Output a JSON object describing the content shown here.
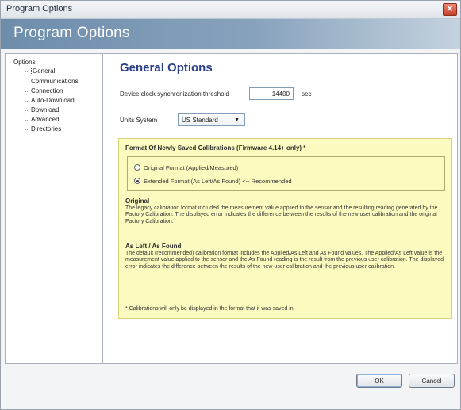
{
  "window": {
    "title": "Program Options",
    "close_glyph": "✕"
  },
  "banner": {
    "title": "Program Options"
  },
  "tree": {
    "root": "Options",
    "items": [
      {
        "label": "General",
        "selected": true
      },
      {
        "label": "Communications"
      },
      {
        "label": "Connection"
      },
      {
        "label": "Auto-Download"
      },
      {
        "label": "Download"
      },
      {
        "label": "Advanced"
      },
      {
        "label": "Directories"
      }
    ]
  },
  "general": {
    "heading": "General Options",
    "clock_label": "Device clock synchronization threshold",
    "clock_value": "14400",
    "clock_unit": "sec",
    "units_label": "Units System",
    "units_value": "US Standard",
    "units_arrow": "▼"
  },
  "format": {
    "title": "Format Of Newly Saved Calibrations (Firmware 4.14+ only) *",
    "option_original": "Original Format (Applied/Measured)",
    "option_extended": "Extended Format (As Left/As Found)  <-- Recommended",
    "selected": "extended",
    "original_heading": "Original",
    "original_text": "The legacy calibration format included the measurement value applied to the sensor and the resulting reading generated by the Factory Calibration. The displayed error indicates the difference between the results of the new user calibration and the original Factory Calibration.",
    "asleft_heading": "As Left / As Found",
    "asleft_text": "The default (recommended) calibration format includes the Applied/As Left  and As Found values.  The Applied/As Left value is the measurement value applied to the sensor and the As Found reading is the result from the previous user calibration.  The displayed error indicates the difference between the results of the new user calibration and the previous user calibration.",
    "footnote": "* Calibrations will only be displayed in the format that it was saved in."
  },
  "buttons": {
    "ok_label": "OK",
    "cancel_label": "Cancel"
  }
}
